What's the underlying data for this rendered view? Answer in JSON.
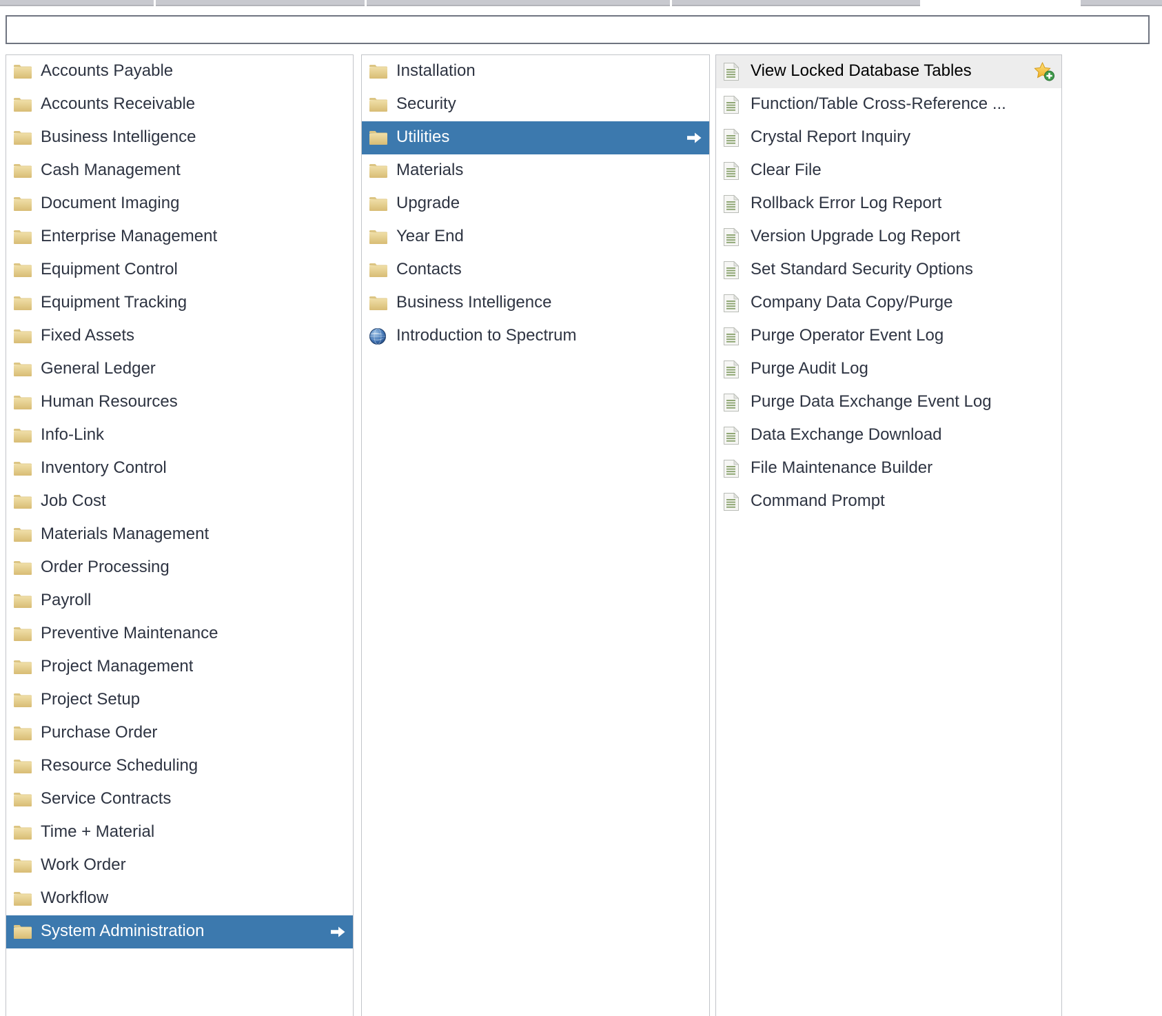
{
  "window": {
    "top_toolbar_segments": 5
  },
  "search": {
    "value": "",
    "placeholder": ""
  },
  "modules_panel": {
    "items": [
      {
        "label": "Accounts Payable",
        "icon": "folder-icon",
        "selected": false,
        "has_arrow": false
      },
      {
        "label": "Accounts Receivable",
        "icon": "folder-icon",
        "selected": false,
        "has_arrow": false
      },
      {
        "label": "Business Intelligence",
        "icon": "folder-icon",
        "selected": false,
        "has_arrow": false
      },
      {
        "label": "Cash Management",
        "icon": "folder-icon",
        "selected": false,
        "has_arrow": false
      },
      {
        "label": "Document Imaging",
        "icon": "folder-icon",
        "selected": false,
        "has_arrow": false
      },
      {
        "label": "Enterprise Management",
        "icon": "folder-icon",
        "selected": false,
        "has_arrow": false
      },
      {
        "label": "Equipment Control",
        "icon": "folder-icon",
        "selected": false,
        "has_arrow": false
      },
      {
        "label": "Equipment Tracking",
        "icon": "folder-icon",
        "selected": false,
        "has_arrow": false
      },
      {
        "label": "Fixed Assets",
        "icon": "folder-icon",
        "selected": false,
        "has_arrow": false
      },
      {
        "label": "General Ledger",
        "icon": "folder-icon",
        "selected": false,
        "has_arrow": false
      },
      {
        "label": "Human Resources",
        "icon": "folder-icon",
        "selected": false,
        "has_arrow": false
      },
      {
        "label": "Info-Link",
        "icon": "folder-icon",
        "selected": false,
        "has_arrow": false
      },
      {
        "label": "Inventory Control",
        "icon": "folder-icon",
        "selected": false,
        "has_arrow": false
      },
      {
        "label": "Job Cost",
        "icon": "folder-icon",
        "selected": false,
        "has_arrow": false
      },
      {
        "label": "Materials Management",
        "icon": "folder-icon",
        "selected": false,
        "has_arrow": false
      },
      {
        "label": "Order Processing",
        "icon": "folder-icon",
        "selected": false,
        "has_arrow": false
      },
      {
        "label": "Payroll",
        "icon": "folder-icon",
        "selected": false,
        "has_arrow": false
      },
      {
        "label": "Preventive Maintenance",
        "icon": "folder-icon",
        "selected": false,
        "has_arrow": false
      },
      {
        "label": "Project Management",
        "icon": "folder-icon",
        "selected": false,
        "has_arrow": false
      },
      {
        "label": "Project Setup",
        "icon": "folder-icon",
        "selected": false,
        "has_arrow": false
      },
      {
        "label": "Purchase Order",
        "icon": "folder-icon",
        "selected": false,
        "has_arrow": false
      },
      {
        "label": "Resource Scheduling",
        "icon": "folder-icon",
        "selected": false,
        "has_arrow": false
      },
      {
        "label": "Service Contracts",
        "icon": "folder-icon",
        "selected": false,
        "has_arrow": false
      },
      {
        "label": "Time + Material",
        "icon": "folder-icon",
        "selected": false,
        "has_arrow": false
      },
      {
        "label": "Work Order",
        "icon": "folder-icon",
        "selected": false,
        "has_arrow": false
      },
      {
        "label": "Workflow",
        "icon": "folder-icon",
        "selected": false,
        "has_arrow": false
      },
      {
        "label": "System Administration",
        "icon": "folder-icon",
        "selected": true,
        "has_arrow": true
      }
    ]
  },
  "folders_panel": {
    "items": [
      {
        "label": "Installation",
        "icon": "folder-icon",
        "selected": false,
        "has_arrow": false
      },
      {
        "label": "Security",
        "icon": "folder-icon",
        "selected": false,
        "has_arrow": false
      },
      {
        "label": "Utilities",
        "icon": "folder-icon",
        "selected": true,
        "has_arrow": true
      },
      {
        "label": "Materials",
        "icon": "folder-icon",
        "selected": false,
        "has_arrow": false
      },
      {
        "label": "Upgrade",
        "icon": "folder-icon",
        "selected": false,
        "has_arrow": false
      },
      {
        "label": "Year End",
        "icon": "folder-icon",
        "selected": false,
        "has_arrow": false
      },
      {
        "label": "Contacts",
        "icon": "folder-icon",
        "selected": false,
        "has_arrow": false
      },
      {
        "label": "Business Intelligence",
        "icon": "folder-icon",
        "selected": false,
        "has_arrow": false
      },
      {
        "label": "Introduction to Spectrum",
        "icon": "globe-icon",
        "selected": false,
        "has_arrow": false
      }
    ]
  },
  "functions_panel": {
    "items": [
      {
        "label": "View Locked Database Tables",
        "icon": "document-icon",
        "hover": true,
        "has_star": true
      },
      {
        "label": "Function/Table Cross-Reference ...",
        "icon": "document-icon",
        "hover": false,
        "has_star": false
      },
      {
        "label": "Crystal Report Inquiry",
        "icon": "document-icon",
        "hover": false,
        "has_star": false
      },
      {
        "label": "Clear File",
        "icon": "document-icon",
        "hover": false,
        "has_star": false
      },
      {
        "label": "Rollback Error Log Report",
        "icon": "document-icon",
        "hover": false,
        "has_star": false
      },
      {
        "label": "Version Upgrade Log Report",
        "icon": "document-icon",
        "hover": false,
        "has_star": false
      },
      {
        "label": "Set Standard Security Options",
        "icon": "document-icon",
        "hover": false,
        "has_star": false
      },
      {
        "label": "Company Data Copy/Purge",
        "icon": "document-icon",
        "hover": false,
        "has_star": false
      },
      {
        "label": "Purge Operator Event Log",
        "icon": "document-icon",
        "hover": false,
        "has_star": false
      },
      {
        "label": "Purge Audit Log",
        "icon": "document-icon",
        "hover": false,
        "has_star": false
      },
      {
        "label": "Purge Data Exchange Event Log",
        "icon": "document-icon",
        "hover": false,
        "has_star": false
      },
      {
        "label": "Data Exchange Download",
        "icon": "document-icon",
        "hover": false,
        "has_star": false
      },
      {
        "label": "File Maintenance Builder",
        "icon": "document-icon",
        "hover": false,
        "has_star": false
      },
      {
        "label": "Command Prompt",
        "icon": "document-icon",
        "hover": false,
        "has_star": false
      }
    ]
  },
  "colors": {
    "selection_blue": "#3c79ae",
    "folder_yellow": "#e3c87e",
    "hover_gray": "#ededed",
    "panel_border": "#c2c4c9",
    "text": "#2e3442",
    "star_gold": "#f2c244",
    "badge_green": "#3f9a4a"
  }
}
